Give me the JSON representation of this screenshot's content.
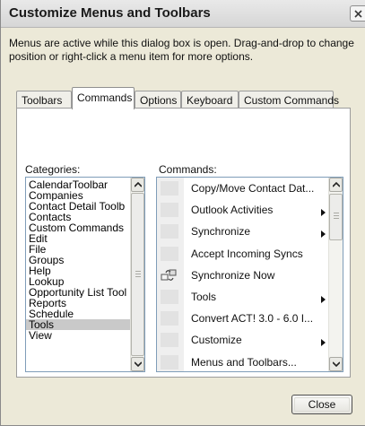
{
  "window": {
    "title": "Customize Menus and Toolbars"
  },
  "instructions": "Menus are active while this dialog box is open. Drag-and-drop to change\nposition or right-click a menu item for more options.",
  "tabs": [
    {
      "label": "Toolbars",
      "active": false
    },
    {
      "label": "Commands",
      "active": true
    },
    {
      "label": "Options",
      "active": false
    },
    {
      "label": "Keyboard",
      "active": false
    },
    {
      "label": "Custom Commands",
      "active": false
    }
  ],
  "categories": {
    "label": "Categories:",
    "selected": "Tools",
    "items": [
      "CalendarToolbar",
      "Companies",
      "Contact Detail Toolb",
      "Contacts",
      "Custom Commands",
      "Edit",
      "File",
      "Groups",
      "Help",
      "Lookup",
      "Opportunity List Tool",
      "Reports",
      "Schedule",
      "Tools",
      "View"
    ]
  },
  "commands": {
    "label": "Commands:",
    "items": [
      {
        "label": "Copy/Move Contact Dat...",
        "submenu": false,
        "icon": "blank"
      },
      {
        "label": "Outlook Activities",
        "submenu": true,
        "icon": "blank"
      },
      {
        "label": "Synchronize",
        "submenu": true,
        "icon": "blank"
      },
      {
        "label": "Accept Incoming Syncs",
        "submenu": false,
        "icon": "blank"
      },
      {
        "label": "Synchronize Now",
        "submenu": false,
        "icon": "synchronize-icon"
      },
      {
        "label": "Tools",
        "submenu": true,
        "icon": "blank"
      },
      {
        "label": "Convert ACT! 3.0 - 6.0 I...",
        "submenu": false,
        "icon": "blank"
      },
      {
        "label": "Customize",
        "submenu": true,
        "icon": "blank"
      },
      {
        "label": "Menus and Toolbars...",
        "submenu": false,
        "icon": "blank"
      }
    ]
  },
  "buttons": {
    "close": "Close"
  }
}
